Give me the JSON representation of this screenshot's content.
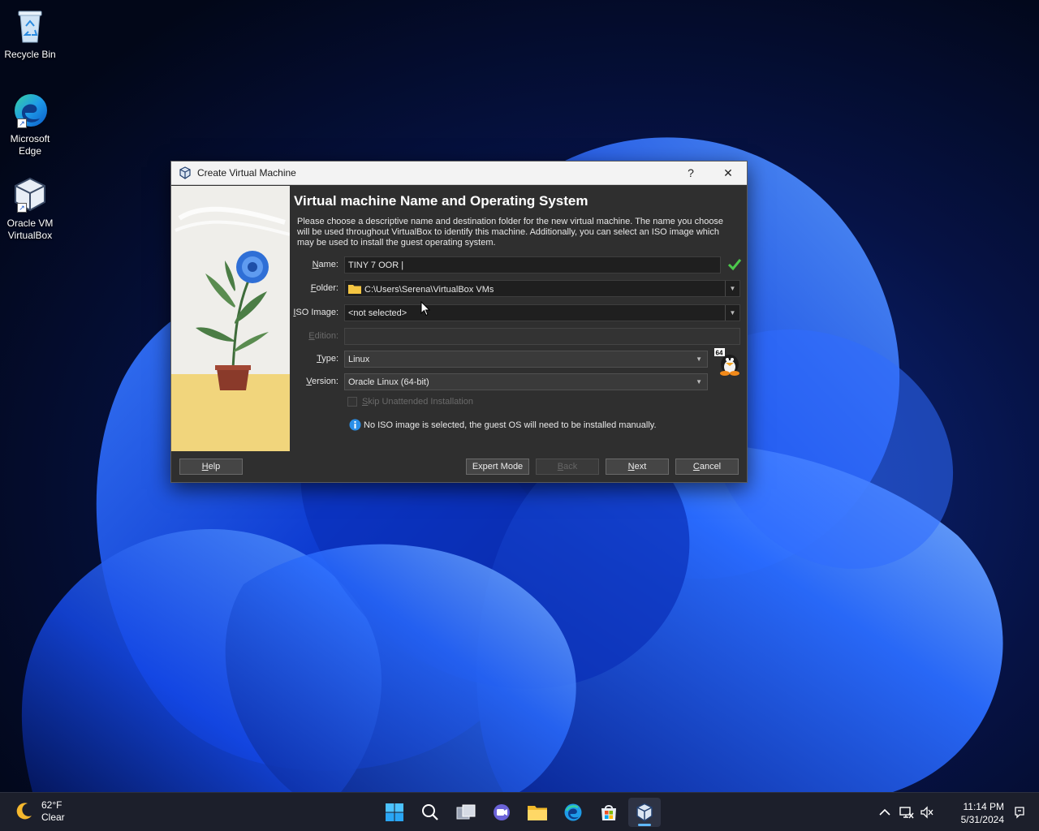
{
  "desktop": {
    "icons": [
      {
        "label_line1": "Recycle Bin",
        "label_line2": ""
      },
      {
        "label_line1": "Microsoft",
        "label_line2": "Edge"
      },
      {
        "label_line1": "Oracle VM",
        "label_line2": "VirtualBox"
      }
    ]
  },
  "dialog": {
    "title": "Create Virtual Machine",
    "help_glyph": "?",
    "close_glyph": "✕",
    "page_title": "Virtual machine Name and Operating System",
    "description": "Please choose a descriptive name and destination folder for the new virtual machine. The name you choose will be used throughout VirtualBox to identify this machine. Additionally, you can select an ISO image which may be used to install the guest operating system.",
    "fields": {
      "name": {
        "label_key": "N",
        "label_rest": "ame:",
        "value": "TINY 7 OOR |"
      },
      "folder": {
        "label_key": "F",
        "label_rest": "older:",
        "value": "C:\\Users\\Serena\\VirtualBox VMs"
      },
      "iso": {
        "label_key": "I",
        "label_rest": "SO Image:",
        "value": "<not selected>"
      },
      "edition": {
        "label_key": "E",
        "label_rest": "dition:",
        "value": ""
      },
      "type": {
        "label_key": "T",
        "label_rest": "ype:",
        "value": "Linux"
      },
      "version": {
        "label_key": "V",
        "label_rest": "ersion:",
        "value": "Oracle Linux (64-bit)"
      }
    },
    "skip_unattended": {
      "label_key": "S",
      "label_rest": "kip Unattended Installation",
      "checked": false
    },
    "info_message": "No ISO image is selected, the guest OS will need to be installed manually.",
    "os_badge": "64",
    "buttons": {
      "help": {
        "key": "H",
        "rest": "elp"
      },
      "expert": {
        "key": "",
        "text": "Expert Mode"
      },
      "back": {
        "key": "B",
        "rest": "ack"
      },
      "next": {
        "key": "N",
        "rest": "ext"
      },
      "cancel": {
        "key": "C",
        "rest": "ancel"
      }
    }
  },
  "taskbar": {
    "weather": {
      "temp": "62°F",
      "condition": "Clear"
    },
    "clock": {
      "time": "11:14 PM",
      "date": "5/31/2024"
    }
  },
  "colors": {
    "dialog_bg": "#2f2f2f",
    "titlebar_bg": "#f3f3f3",
    "field_bg": "#1f1f1f",
    "accent": "#5fb8ff",
    "ok_green": "#3fbf3f"
  }
}
